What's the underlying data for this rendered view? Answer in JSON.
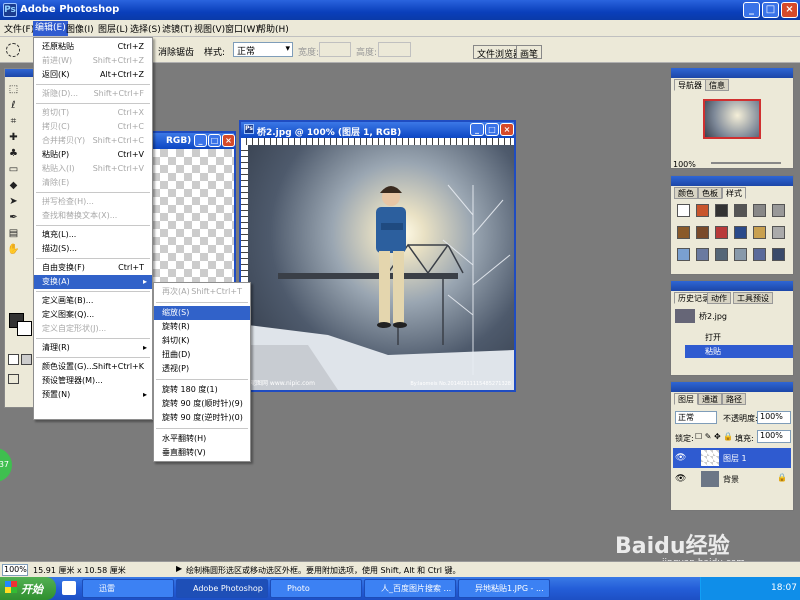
{
  "window": {
    "title": "Adobe Photoshop"
  },
  "menubar": {
    "items": [
      "文件(F)",
      "编辑(E)",
      "图像(I)",
      "图层(L)",
      "选择(S)",
      "滤镜(T)",
      "视图(V)",
      "窗口(W)",
      "帮助(H)"
    ]
  },
  "options": {
    "feather_fragment": "消除锯齿",
    "style_label": "样式:",
    "style_value": "正常",
    "width_label": "宽度:",
    "height_label": "高度:",
    "file_browser_tab": "文件浏览器",
    "brushes_tab": "画笔"
  },
  "edit_menu": [
    {
      "label": "还原粘贴",
      "shortcut": "Ctrl+Z",
      "disabled": false
    },
    {
      "label": "前进(W)",
      "shortcut": "Shift+Ctrl+Z",
      "disabled": true
    },
    {
      "label": "返回(K)",
      "shortcut": "Alt+Ctrl+Z",
      "disabled": false
    },
    {
      "label": "渐隐(D)...",
      "shortcut": "Shift+Ctrl+F",
      "disabled": true
    },
    {
      "label": "剪切(T)",
      "shortcut": "Ctrl+X",
      "disabled": true
    },
    {
      "label": "拷贝(C)",
      "shortcut": "Ctrl+C",
      "disabled": true
    },
    {
      "label": "合并拷贝(Y)",
      "shortcut": "Shift+Ctrl+C",
      "disabled": true
    },
    {
      "label": "粘贴(P)",
      "shortcut": "Ctrl+V",
      "disabled": false
    },
    {
      "label": "粘贴入(I)",
      "shortcut": "Shift+Ctrl+V",
      "disabled": true
    },
    {
      "label": "清除(E)",
      "shortcut": "",
      "disabled": true
    },
    {
      "label": "拼写检查(H)...",
      "shortcut": "",
      "disabled": true
    },
    {
      "label": "查找和替换文本(X)...",
      "shortcut": "",
      "disabled": true
    },
    {
      "label": "填充(L)...",
      "shortcut": "",
      "disabled": false
    },
    {
      "label": "描边(S)...",
      "shortcut": "",
      "disabled": false
    },
    {
      "label": "自由变换(F)",
      "shortcut": "Ctrl+T",
      "disabled": false
    },
    {
      "label": "变换(A)",
      "shortcut": "",
      "disabled": false,
      "submenu": true
    },
    {
      "label": "定义画笔(B)...",
      "shortcut": "",
      "disabled": false
    },
    {
      "label": "定义图案(Q)...",
      "shortcut": "",
      "disabled": false
    },
    {
      "label": "定义自定形状(J)...",
      "shortcut": "",
      "disabled": true
    },
    {
      "label": "清理(R)",
      "shortcut": "",
      "disabled": false,
      "submenu": true
    },
    {
      "label": "颜色设置(G)...",
      "shortcut": "Shift+Ctrl+K",
      "disabled": false
    },
    {
      "label": "预设管理器(M)...",
      "shortcut": "",
      "disabled": false
    },
    {
      "label": "预置(N)",
      "shortcut": "",
      "disabled": false,
      "submenu": true
    }
  ],
  "transform_menu": [
    {
      "label": "再次(A)",
      "shortcut": "Shift+Ctrl+T",
      "disabled": true
    },
    {
      "label": "缩放(S)",
      "shortcut": "",
      "disabled": false
    },
    {
      "label": "旋转(R)",
      "shortcut": "",
      "disabled": false
    },
    {
      "label": "斜切(K)",
      "shortcut": "",
      "disabled": false
    },
    {
      "label": "扭曲(D)",
      "shortcut": "",
      "disabled": false
    },
    {
      "label": "透视(P)",
      "shortcut": "",
      "disabled": false
    },
    {
      "label": "旋转 180 度(1)",
      "shortcut": "",
      "disabled": false
    },
    {
      "label": "旋转 90 度(顺时针)(9)",
      "shortcut": "",
      "disabled": false
    },
    {
      "label": "旋转 90 度(逆时针)(0)",
      "shortcut": "",
      "disabled": false
    },
    {
      "label": "水平翻转(H)",
      "shortcut": "",
      "disabled": false
    },
    {
      "label": "垂直翻转(V)",
      "shortcut": "",
      "disabled": false
    }
  ],
  "doc_back": {
    "title_fragment": "RGB)"
  },
  "doc_front": {
    "title": "桥2.jpg @ 100% (图层 1, RGB)",
    "watermark_left": "昵图网 www.nipic.com",
    "watermark_right": "By:laomeis No.20140311115485271328"
  },
  "navigator": {
    "tabs": [
      "导航器",
      "信息"
    ],
    "zoom": "100%"
  },
  "swatches": {
    "tabs": [
      "颜色",
      "色板",
      "样式"
    ]
  },
  "history": {
    "tabs": [
      "历史记录",
      "动作",
      "工具预设"
    ],
    "snapshot": "桥2.jpg",
    "items": [
      "打开",
      "粘贴"
    ]
  },
  "layers": {
    "tabs": [
      "图层",
      "通道",
      "路径"
    ],
    "blend_mode": "正常",
    "opacity_label": "不透明度:",
    "opacity_value": "100%",
    "lock_label": "锁定:",
    "fill_label": "填充:",
    "fill_value": "100%",
    "rows": [
      {
        "name": "图层 1",
        "selected": true
      },
      {
        "name": "背景",
        "selected": false
      }
    ]
  },
  "status": {
    "zoom": "100%",
    "doc_size": "15.91 厘米 x 10.58 厘米",
    "hint": "绘制椭圆形选区或移动选区外框。要用附加选项，使用 Shift, Alt 和 Ctrl 键。"
  },
  "taskbar": {
    "start": "开始",
    "tasks": [
      "迅雷",
      "Adobe Photoshop",
      "Photo",
      "人_百度图片搜索 ...",
      "异地粘贴1.JPG - ..."
    ],
    "clock": "18:07"
  },
  "page_watermark": {
    "brand": "Baidu经验",
    "url": "jingyan.baidu.com"
  },
  "badge": "37",
  "colors": {
    "titlebar": "#0a3fbb",
    "menu_highlight": "#3162c9",
    "workspace": "#7b7b7b"
  }
}
